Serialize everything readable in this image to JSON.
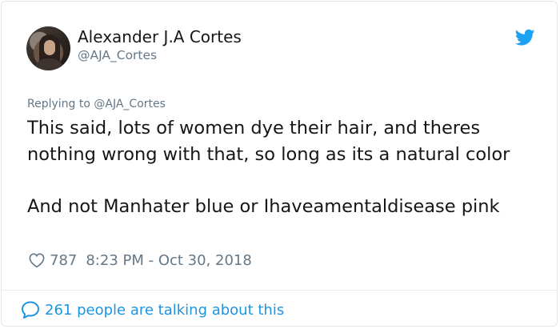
{
  "tweet": {
    "author_name": "Alexander J.A Cortes",
    "author_handle": "@AJA_Cortes",
    "replying_to": "Replying to @AJA_Cortes",
    "paragraphs": [
      "This said, lots of women dye their hair, and theres nothing wrong with that, so long as its a natural color",
      "And not Manhater blue or Ihaveamentaldisease pink"
    ],
    "like_count": "787",
    "timestamp": "8:23 PM - Oct 30, 2018",
    "conversation_text": "261 people are talking about this"
  },
  "colors": {
    "text": "#14171a",
    "muted": "#657786",
    "link_blue": "#1b95e0",
    "twitter_blue": "#1da1f2",
    "border": "#e1e8ed"
  },
  "icons": {
    "brand": "twitter-bird-icon",
    "like": "heart-outline-icon",
    "conversation": "speech-bubble-icon"
  }
}
